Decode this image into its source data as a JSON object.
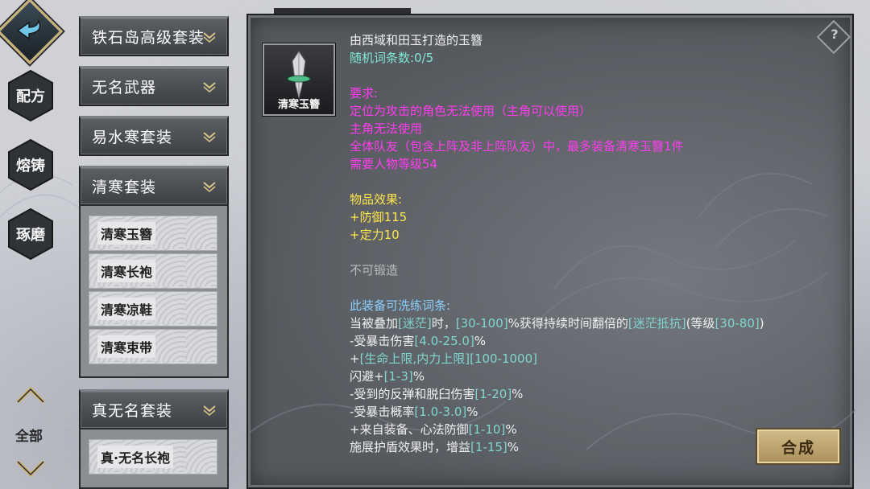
{
  "nav": {
    "tabs": [
      {
        "label": "配方"
      },
      {
        "label": "熔铸"
      },
      {
        "label": "琢磨"
      }
    ],
    "all_label": "全部"
  },
  "categories": [
    {
      "label": "铁石岛高级套装"
    },
    {
      "label": "无名武器"
    },
    {
      "label": "易水寒套装"
    },
    {
      "label": "清寒套装"
    },
    {
      "label": "真无名套装"
    }
  ],
  "qinghan_items": [
    "清寒玉簪",
    "清寒长袍",
    "清寒凉鞋",
    "清寒束带"
  ],
  "zhenwuming_items": [
    "真·无名长袍"
  ],
  "item": {
    "name": "清寒玉簪",
    "description": "由西域和田玉打造的玉簪",
    "random_affix": "随机词条数:0/5",
    "req_title": "要求:",
    "req_lines": [
      "定位为攻击的角色无法使用（主角可以使用）",
      "主角无法使用",
      "全体队友（包含上阵及非上阵队友）中，最多装备清寒玉簪1件",
      "需要人物等级54"
    ],
    "effect_title": "物品效果:",
    "effects": [
      "+防御115",
      "+定力10"
    ],
    "forge": "不可锻造",
    "refine_title": "此装备可洗练词条:",
    "refine_lines": [
      [
        "当被叠加",
        "[迷茫]",
        "时，",
        "[30-100]",
        "%获得持续时间翻倍的",
        "[迷茫抵抗]",
        "(等级",
        "[30-80]",
        ")"
      ],
      [
        "-受暴击伤害",
        "[4.0-25.0]",
        "%"
      ],
      [
        "+",
        "[生命上限,内力上限]",
        "[100-1000]"
      ],
      [
        "闪避+",
        "[1-3]",
        "%"
      ],
      [
        "-受到的反弹和脱臼伤害",
        "[1-20]",
        "%"
      ],
      [
        "-受暴击概率",
        "[1.0-3.0]",
        "%"
      ],
      [
        "+来自装备、心法防御",
        "[1-10]",
        "%"
      ],
      [
        "施展护盾效果时，增益",
        "[1-15]",
        "%"
      ]
    ]
  },
  "craft_label": "合成",
  "help_label": "?",
  "colors": {
    "requirement": "#ff3cf0",
    "effect": "#ffe84a",
    "refine_title": "#8ad0ff",
    "range": "#7fd6d0",
    "craft_button": "#c2a874"
  }
}
